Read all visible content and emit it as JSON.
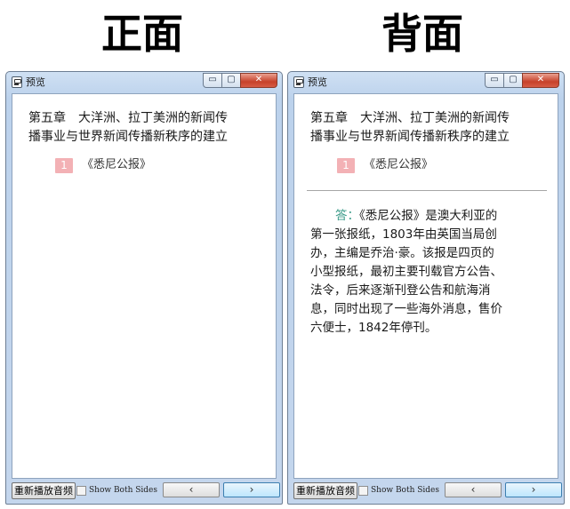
{
  "labels": {
    "front": "正面",
    "back": "背面"
  },
  "window": {
    "title": "预览",
    "min_symbol": "▭",
    "max_symbol": "▢",
    "close_symbol": "✕"
  },
  "card": {
    "chapter_line1": "第五章　大洋洲、拉丁美洲的新闻传",
    "chapter_line2": "播事业与世界新闻传播新秩序的建立",
    "number": "1",
    "question": "《悉尼公报》",
    "answer_label": "答：",
    "answer_lines": [
      "《悉尼公报》是澳大利亚的",
      "第一张报纸，1803年由英国当局创",
      "办，主编是乔治·豪。该报是四页的",
      "小型报纸，最初主要刊载官方公告、",
      "法令，后来逐渐刊登公告和航海消",
      "息，同时出现了一些海外消息，售价",
      "六便士，1842年停刊。"
    ]
  },
  "bottom": {
    "replay_label": "重新播放音频",
    "show_both_label": "Show Both Sides",
    "show_both_checked": false,
    "prev_label": "‹",
    "next_label": "›"
  }
}
